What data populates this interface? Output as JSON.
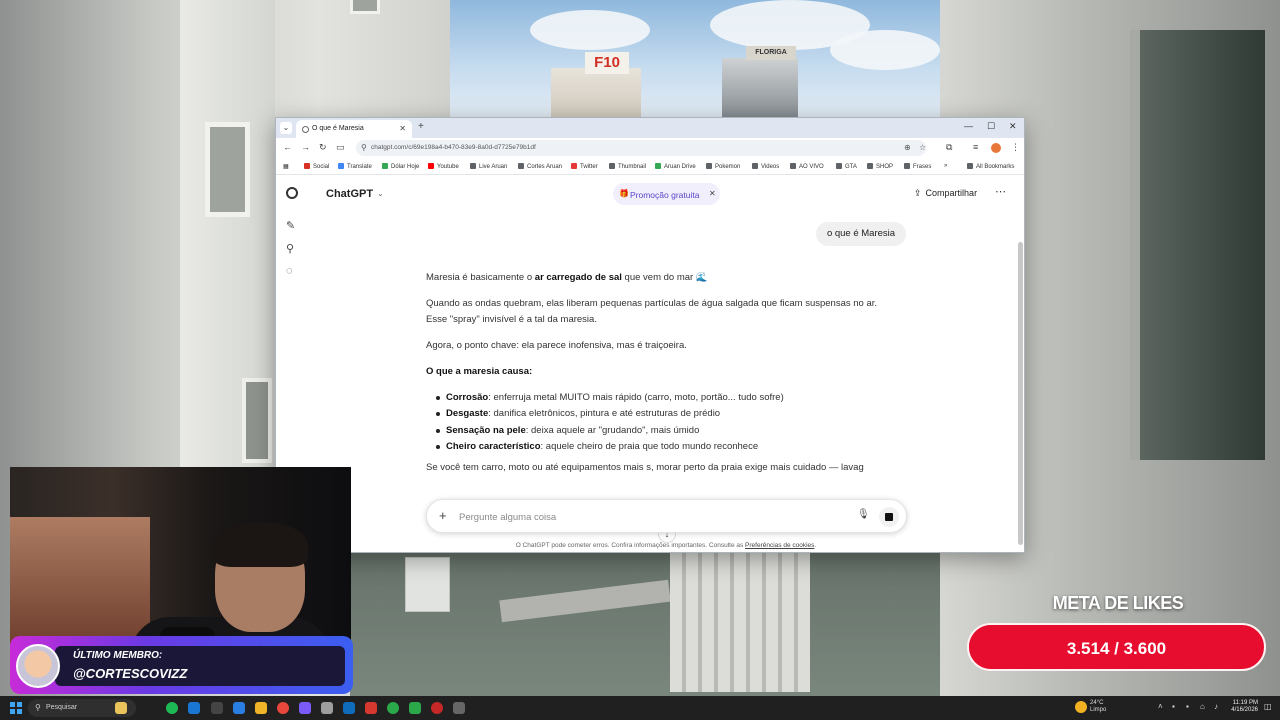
{
  "browser": {
    "tab_title": "O que é Maresia",
    "url": "chatgpt.com/c/69e198a4-b470-83e9-8a0d-d7725e79b1df",
    "bookmarks": [
      {
        "label": "Social",
        "color": "#d93025"
      },
      {
        "label": "Translate",
        "color": "#4285f4"
      },
      {
        "label": "Dólar Hoje",
        "color": "#34a853"
      },
      {
        "label": "Youtube",
        "color": "#ff0000"
      },
      {
        "label": "Live Aruan",
        "color": "#5f6368"
      },
      {
        "label": "Cortes Aruan",
        "color": "#5f6368"
      },
      {
        "label": "Twitter",
        "color": "#e53935"
      },
      {
        "label": "Thumbnail",
        "color": "#5f6368"
      },
      {
        "label": "Aruan Drive",
        "color": "#34a853"
      },
      {
        "label": "Pokemon",
        "color": "#5f6368"
      },
      {
        "label": "Videos",
        "color": "#5f6368"
      },
      {
        "label": "AO VIVO",
        "color": "#5f6368"
      },
      {
        "label": "GTA",
        "color": "#5f6368"
      },
      {
        "label": "SHOP",
        "color": "#5f6368"
      },
      {
        "label": "Frases",
        "color": "#5f6368"
      }
    ],
    "more_bookmarks": "»",
    "all_bookmarks": "All Bookmarks"
  },
  "chatgpt": {
    "model_name": "ChatGPT",
    "promo_label": "Promoção gratuita",
    "share_label": "Compartilhar",
    "user_message": "o que é Maresia",
    "answer": {
      "p1_pre": "Maresia é basicamente o ",
      "p1_bold": "ar carregado de sal",
      "p1_post": " que vem do mar 🌊",
      "p2_line1": "Quando as ondas quebram, elas liberam pequenas partículas de água salgada que ficam suspensas no ar.",
      "p2_line2": "Esse \"spray\" invisível é a tal da maresia.",
      "p3": "Agora, o ponto chave: ela parece inofensiva, mas é traiçoeira.",
      "heading": "O que a maresia causa:",
      "items": [
        {
          "term": "Corrosão",
          "text": ": enferruja metal MUITO mais rápido (carro, moto, portão... tudo sofre)"
        },
        {
          "term": "Desgaste",
          "text": ": danifica eletrônicos, pintura e até estruturas de prédio"
        },
        {
          "term": "Sensação na pele",
          "text": ": deixa aquele ar \"grudando\", mais úmido"
        },
        {
          "term": "Cheiro característico",
          "text": ": aquele cheiro de praia que todo mundo reconhece"
        }
      ],
      "last_line": "Se você tem carro, moto ou até equipamentos mais s, morar perto da praia exige mais cuidado — lavag"
    },
    "composer_placeholder": "Pergunte alguma coisa",
    "disclaimer_text": "O ChatGPT pode cometer erros. Confira informações importantes. Consulte as ",
    "disclaimer_link": "Preferências de cookies",
    "disclaimer_end": "."
  },
  "stream": {
    "member_label": "ÚLTIMO MEMBRO:",
    "member_name": "@CORTESCOVIZZ",
    "likes_title": "META DE LIKES",
    "likes_value": "3.514 / 3.600",
    "likes_progress": 0.976
  },
  "taskbar": {
    "search_label": "Pesquisar",
    "weather_temp": "24°C",
    "weather_desc": "Limpo",
    "time": "11:19 PM",
    "date": "4/16/2026"
  },
  "scene": {
    "sign_left": "F10",
    "sign_right": "FLORIGA"
  }
}
